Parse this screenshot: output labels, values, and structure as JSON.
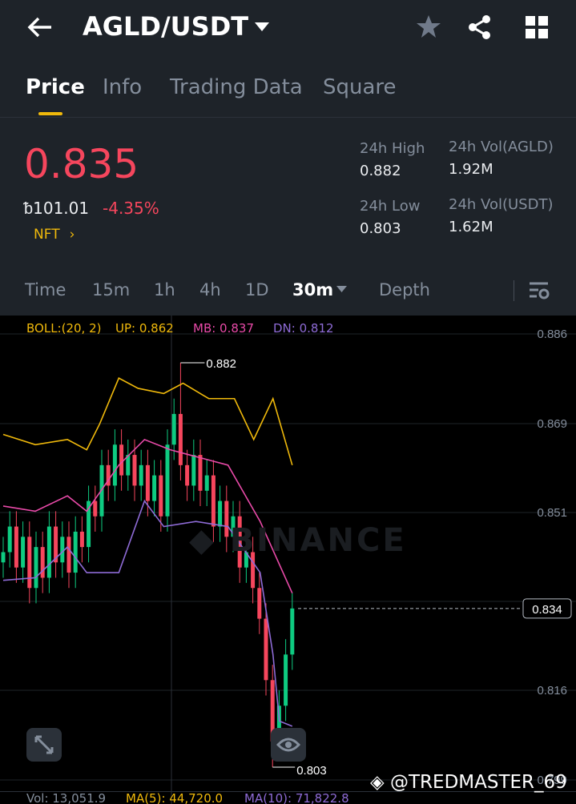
{
  "header": {
    "title": "AGLD/USDT"
  },
  "tabs": [
    "Price",
    "Info",
    "Trading Data",
    "Square"
  ],
  "ticker": {
    "last_price": "0.835",
    "fiat_price": "ᵬ101.01",
    "change": "-4.35%",
    "tag": "NFT",
    "high_label": "24h High",
    "high": "0.882",
    "low_label": "24h Low",
    "low": "0.803",
    "vol_base_label": "24h Vol(AGLD)",
    "vol_base": "1.92M",
    "vol_quote_label": "24h Vol(USDT)",
    "vol_quote": "1.62M"
  },
  "intervals": [
    "Time",
    "15m",
    "1h",
    "4h",
    "1D",
    "30m",
    "Depth"
  ],
  "colors": {
    "up": "#0ecb81",
    "down": "#f6465d",
    "accent": "#f0b90b",
    "boll_up": "#f0b90b",
    "boll_mb": "#e84aa8",
    "boll_dn": "#8e6bd6"
  },
  "chart_data": {
    "type": "candlestick",
    "indicator": {
      "boll": "BOLL:(20, 2)",
      "up": "UP: 0.862",
      "mb": "MB: 0.837",
      "dn": "DN: 0.812"
    },
    "y_ticks": [
      "0.886",
      "0.869",
      "0.851",
      "0.834",
      "0.816",
      "0.799"
    ],
    "y_tick_values": [
      0.886,
      0.869,
      0.851,
      0.834,
      0.816,
      0.799
    ],
    "current_price": "0.834",
    "current_value": 0.834,
    "max_label": "0.882",
    "max_value": 0.882,
    "max_index": 27,
    "min_label": "0.803",
    "min_value": 0.803,
    "min_index": 41,
    "closes": [
      0.845,
      0.85,
      0.842,
      0.848,
      0.838,
      0.846,
      0.84,
      0.85,
      0.843,
      0.848,
      0.841,
      0.849,
      0.846,
      0.855,
      0.852,
      0.862,
      0.858,
      0.866,
      0.86,
      0.864,
      0.858,
      0.862,
      0.855,
      0.86,
      0.852,
      0.866,
      0.872,
      0.862,
      0.858,
      0.864,
      0.857,
      0.86,
      0.85,
      0.855,
      0.848,
      0.852,
      0.842,
      0.845,
      0.838,
      0.832,
      0.82,
      0.808,
      0.815,
      0.825,
      0.834
    ],
    "boll_up": [
      [
        0,
        0.868
      ],
      [
        5,
        0.866
      ],
      [
        10,
        0.867
      ],
      [
        13,
        0.865
      ],
      [
        15,
        0.87
      ],
      [
        18,
        0.879
      ],
      [
        21,
        0.877
      ],
      [
        25,
        0.876
      ],
      [
        28,
        0.878
      ],
      [
        32,
        0.875
      ],
      [
        36,
        0.875
      ],
      [
        39,
        0.867
      ],
      [
        42,
        0.875
      ],
      [
        45,
        0.862
      ]
    ],
    "boll_mb": [
      [
        0,
        0.854
      ],
      [
        5,
        0.853
      ],
      [
        10,
        0.856
      ],
      [
        13,
        0.853
      ],
      [
        18,
        0.862
      ],
      [
        22,
        0.867
      ],
      [
        26,
        0.865
      ],
      [
        29,
        0.864
      ],
      [
        35,
        0.862
      ],
      [
        40,
        0.851
      ],
      [
        45,
        0.837
      ]
    ],
    "boll_dn": [
      [
        0,
        0.8395
      ],
      [
        5,
        0.84
      ],
      [
        10,
        0.846
      ],
      [
        13,
        0.841
      ],
      [
        18,
        0.841
      ],
      [
        22,
        0.855
      ],
      [
        25,
        0.85
      ],
      [
        30,
        0.851
      ],
      [
        35,
        0.85
      ],
      [
        40,
        0.841
      ],
      [
        42,
        0.825
      ],
      [
        43,
        0.812
      ],
      [
        45,
        0.811
      ]
    ]
  },
  "volume": {
    "vol": "Vol: 13,051.9",
    "ma5": "MA(5): 44,720.0",
    "ma10": "MA(10): 71,822.8"
  },
  "watermark": "@TREDMASTER_69",
  "logo_watermark": "BINANCE"
}
